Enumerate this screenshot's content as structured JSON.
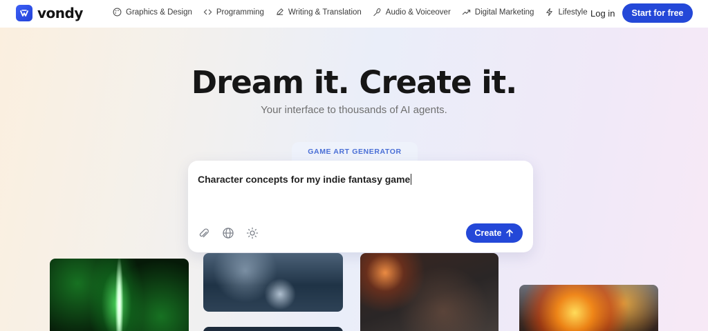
{
  "brand": {
    "name": "vondy",
    "accent": "#2448d8"
  },
  "nav": {
    "links": [
      {
        "label": "Graphics & Design",
        "icon": "palette-icon"
      },
      {
        "label": "Programming",
        "icon": "code-icon"
      },
      {
        "label": "Writing & Translation",
        "icon": "pen-icon"
      },
      {
        "label": "Audio & Voiceover",
        "icon": "microphone-icon"
      },
      {
        "label": "Digital Marketing",
        "icon": "trend-icon"
      },
      {
        "label": "Lifestyle",
        "icon": "lightning-icon"
      }
    ],
    "login_label": "Log in",
    "cta_label": "Start for free"
  },
  "hero": {
    "title": "Dream it. Create it.",
    "subtitle": "Your interface to thousands of AI agents."
  },
  "generator": {
    "tag": "GAME ART GENERATOR",
    "prompt_value": "Character concepts for my indie fantasy game",
    "tools": [
      "paperclip-icon",
      "globe-icon",
      "sun-icon"
    ],
    "create_label": "Create"
  },
  "gallery": {
    "items": [
      "green-lightning-image",
      "ocean-blur-image",
      "dark-image",
      "debris-explosion-image",
      "fire-explosion-image"
    ]
  }
}
